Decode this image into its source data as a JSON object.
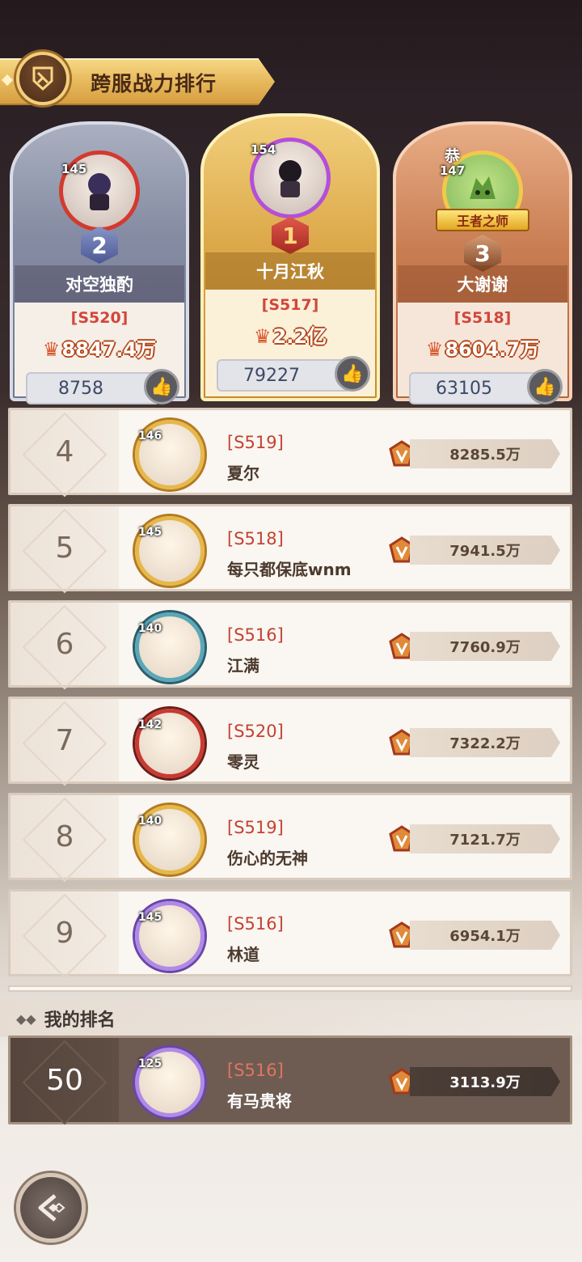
{
  "header": {
    "title": "跨服战力排行",
    "emblem_icon": "ranking-emblem-icon"
  },
  "top3": [
    {
      "rank": "2",
      "level": "145",
      "name": "对空独酌",
      "server": "[S520]",
      "power": "8847.4万",
      "likes": "8758"
    },
    {
      "rank": "1",
      "level": "154",
      "name": "十月江秋",
      "server": "[S517]",
      "power": "2.2亿",
      "likes": "79227"
    },
    {
      "rank": "3",
      "level": "147",
      "name": "大谢谢",
      "server": "[S518]",
      "power": "8604.7万",
      "likes": "63105",
      "greeting": "恭",
      "title_tag": "王者之师"
    }
  ],
  "list": [
    {
      "rank": "4",
      "level": "146",
      "server": "[S519]",
      "name": "夏尔",
      "power": "8285.5万"
    },
    {
      "rank": "5",
      "level": "145",
      "server": "[S518]",
      "name": "每只都保底wnm",
      "power": "7941.5万"
    },
    {
      "rank": "6",
      "level": "140",
      "server": "[S516]",
      "name": "江满",
      "power": "7760.9万"
    },
    {
      "rank": "7",
      "level": "142",
      "server": "[S520]",
      "name": "零灵",
      "power": "7322.2万"
    },
    {
      "rank": "8",
      "level": "140",
      "server": "[S519]",
      "name": "伤心的无神",
      "power": "7121.7万"
    },
    {
      "rank": "9",
      "level": "145",
      "server": "[S516]",
      "name": "林道",
      "power": "6954.1万"
    }
  ],
  "my_rank": {
    "label": "我的排名",
    "rank": "50",
    "level": "125",
    "server": "[S516]",
    "name": "有马贵将",
    "power": "3113.9万"
  },
  "colors": {
    "accent_gold": "#e7b95c",
    "server_red": "#c24335",
    "panel_brown": "#6e5c52"
  },
  "icons": {
    "like": "thumbs-up-icon",
    "power": "power-crest-icon",
    "back": "back-arrow-icon"
  }
}
